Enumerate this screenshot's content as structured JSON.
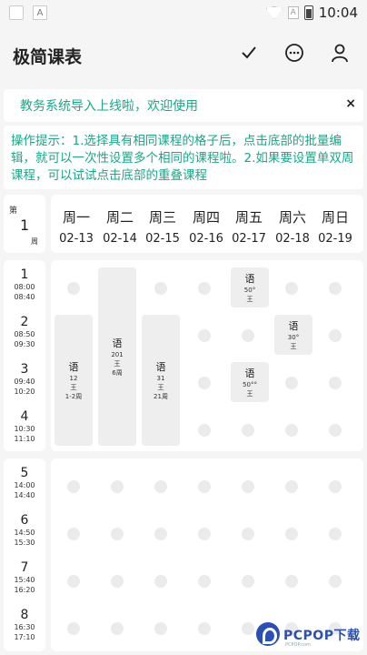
{
  "status_bar": {
    "time": "10:04",
    "notif_icon": "A",
    "sim_icon": "A"
  },
  "app": {
    "title": "极简课表"
  },
  "toolbar": {
    "icons": [
      "check-icon",
      "chat-icon",
      "user-icon"
    ]
  },
  "notice": {
    "text": "教务系统导入上线啦，欢迎使用",
    "close": "×"
  },
  "tips": {
    "text": "操作提示：1.选择具有相同课程的格子后，点击底部的批量编辑，就可以一次性设置多个相同的课程啦。2.如果要设置单双周课程，可以试试点击底部的重叠课程"
  },
  "week": {
    "prefix": "第",
    "number": "1",
    "suffix": "周"
  },
  "days": [
    {
      "name": "周一",
      "date": "02-13"
    },
    {
      "name": "周二",
      "date": "02-14"
    },
    {
      "name": "周三",
      "date": "02-15"
    },
    {
      "name": "周四",
      "date": "02-16"
    },
    {
      "name": "周五",
      "date": "02-17"
    },
    {
      "name": "周六",
      "date": "02-18"
    },
    {
      "name": "周日",
      "date": "02-19"
    }
  ],
  "periods": [
    {
      "num": "1",
      "start": "08:00",
      "end": "08:40"
    },
    {
      "num": "2",
      "start": "08:50",
      "end": "09:30"
    },
    {
      "num": "3",
      "start": "09:40",
      "end": "10:20"
    },
    {
      "num": "4",
      "start": "10:30",
      "end": "11:10"
    },
    {
      "num": "5",
      "start": "14:00",
      "end": "14:40"
    },
    {
      "num": "6",
      "start": "14:50",
      "end": "15:30"
    },
    {
      "num": "7",
      "start": "15:40",
      "end": "16:20"
    },
    {
      "num": "8",
      "start": "16:30",
      "end": "17:10"
    }
  ],
  "courses": [
    {
      "name": "语",
      "room": "12",
      "teacher": "王",
      "weeks": "1-2周"
    },
    {
      "name": "语",
      "room": "201",
      "teacher": "王",
      "weeks": "6周"
    },
    {
      "name": "语",
      "room": "31",
      "teacher": "王",
      "weeks": "21周"
    },
    {
      "name": "语",
      "room": "50°",
      "teacher": "王",
      "weeks": ""
    },
    {
      "name": "语",
      "room": "50°°",
      "teacher": "王",
      "weeks": ""
    },
    {
      "name": "语",
      "room": "30°",
      "teacher": "王",
      "weeks": ""
    }
  ],
  "watermark": {
    "text": "PCPOP下载",
    "sub": "PCPOP.com"
  }
}
